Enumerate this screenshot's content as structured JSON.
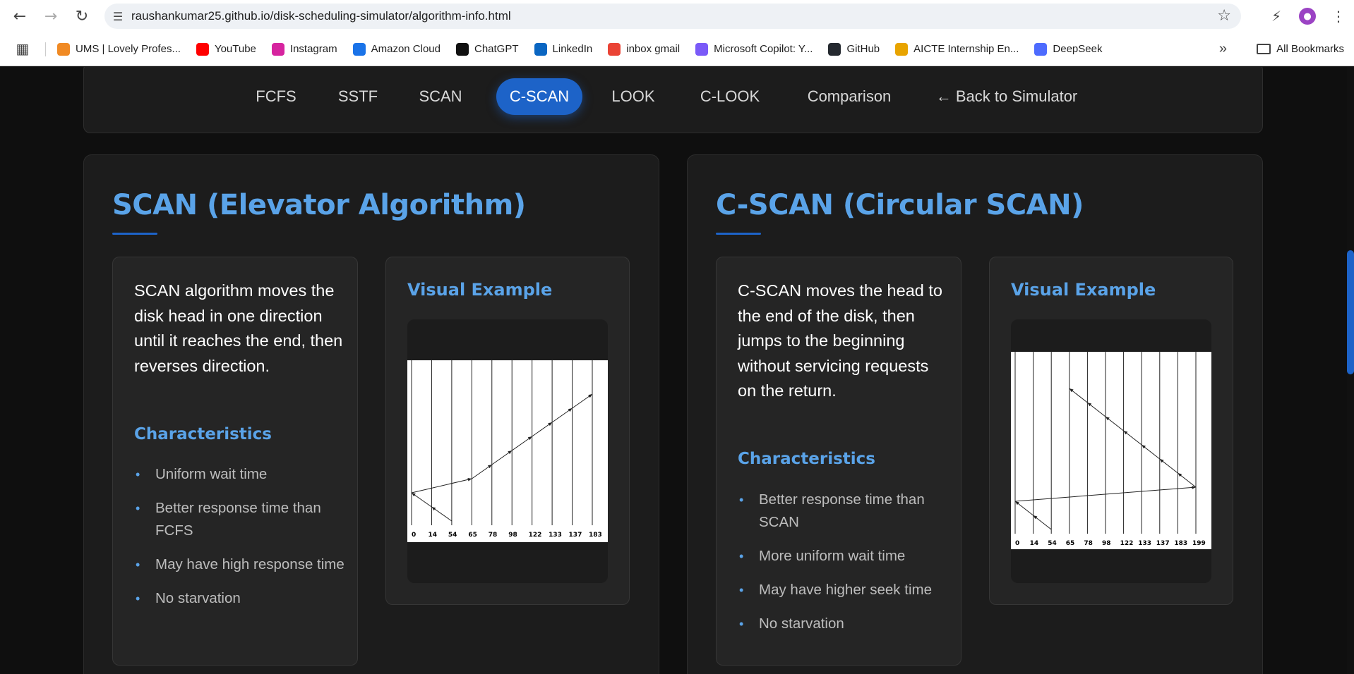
{
  "browser": {
    "url": "raushankumar25.github.io/disk-scheduling-simulator/algorithm-info.html",
    "bookmarks": [
      {
        "label": "UMS | Lovely Profes...",
        "color": "#f08a24"
      },
      {
        "label": "YouTube",
        "color": "#ff0000"
      },
      {
        "label": "Instagram",
        "color": "#d6249f"
      },
      {
        "label": "Amazon Cloud",
        "color": "#1a73e8"
      },
      {
        "label": "ChatGPT",
        "color": "#111111"
      },
      {
        "label": "LinkedIn",
        "color": "#0a66c2"
      },
      {
        "label": "inbox gmail",
        "color": "#ea4335"
      },
      {
        "label": "Microsoft Copilot: Y...",
        "color": "#7a5af8"
      },
      {
        "label": "GitHub",
        "color": "#24292f"
      },
      {
        "label": "AICTE Internship En...",
        "color": "#e8a400"
      },
      {
        "label": "DeepSeek",
        "color": "#4d6bfe"
      }
    ],
    "all_bookmarks": "All Bookmarks"
  },
  "tabs": {
    "fcfs": "FCFS",
    "sstf": "SSTF",
    "scan": "SCAN",
    "cscan": "C-SCAN",
    "look": "LOOK",
    "clook": "C-LOOK",
    "comparison": "Comparison",
    "back": "Back to Simulator",
    "active": "C-SCAN"
  },
  "scan": {
    "title": "SCAN (Elevator Algorithm)",
    "description": "SCAN algorithm moves the disk head in one direction until it reaches the end, then reverses direction.",
    "characteristics_title": "Characteristics",
    "characteristics": [
      "Uniform wait time",
      "Better response time than FCFS",
      "May have high response time",
      "No starvation"
    ],
    "visual_title": "Visual Example",
    "axis_ticks": [
      "0",
      "14",
      "54",
      "65",
      "78",
      "98",
      "122",
      "133",
      "137",
      "183"
    ]
  },
  "cscan": {
    "title": "C-SCAN (Circular SCAN)",
    "description": "C-SCAN moves the head to the end of the disk, then jumps to the beginning without servicing requests on the return.",
    "characteristics_title": "Characteristics",
    "characteristics": [
      "Better response time than SCAN",
      "More uniform wait time",
      "May have higher seek time",
      "No starvation"
    ],
    "visual_title": "Visual Example",
    "axis_ticks": [
      "0",
      "14",
      "54",
      "65",
      "78",
      "98",
      "122",
      "133",
      "137",
      "183",
      "199"
    ]
  },
  "colors": {
    "accent": "#5aa3e8",
    "active_tab": "#1d63c8",
    "card_bg": "#1c1c1c",
    "panel_bg": "#252525"
  }
}
